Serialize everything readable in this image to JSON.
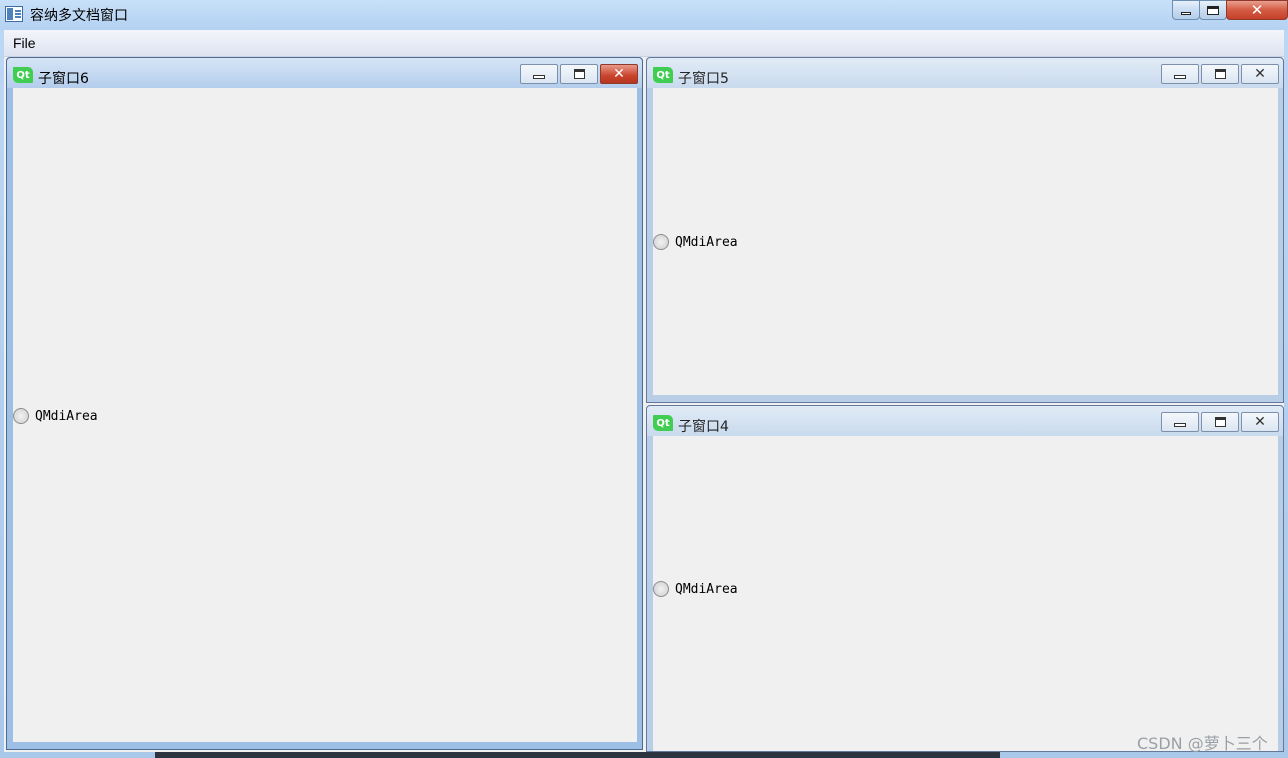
{
  "window": {
    "title": "容纳多文档窗口",
    "controls": {
      "minimize": "—",
      "maximize": "□",
      "close": "✕"
    }
  },
  "menubar": {
    "items": [
      {
        "label": "File"
      }
    ]
  },
  "subwindows": [
    {
      "title": "子窗口6",
      "icon_text": "Qt",
      "radio_label": "QMdiArea",
      "active": true
    },
    {
      "title": "子窗口5",
      "icon_text": "Qt",
      "radio_label": "QMdiArea",
      "active": false
    },
    {
      "title": "子窗口4",
      "icon_text": "Qt",
      "radio_label": "QMdiArea",
      "active": false
    }
  ],
  "subwindow_controls": {
    "close_glyph": "✕"
  },
  "watermark": "CSDN @萝卜三个",
  "colors": {
    "qt_green": "#41cd52",
    "active_close": "#c9432c",
    "frame_blue": "#aac8ea"
  }
}
